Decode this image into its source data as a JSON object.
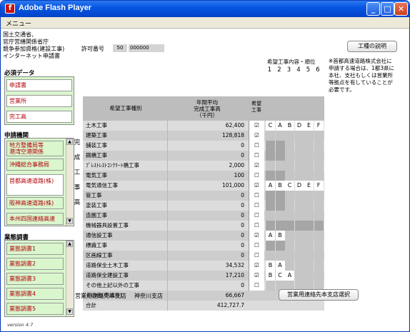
{
  "window": {
    "title": "Adobe Flash Player",
    "menu": "メニュー",
    "app_icon": "flash-icon",
    "minimize": "_",
    "maximize": "□",
    "close": "✕"
  },
  "ministry": [
    "国土交通省、",
    "官庁営繕関係省庁",
    "競争参加資格(建設工事)",
    "インターネット申請書"
  ],
  "permit": {
    "label": "許可番号",
    "code1": "50",
    "code2": "000000"
  },
  "explain_button": "工種の説明",
  "required": {
    "heading": "必須データ",
    "items": [
      "申請書",
      "営業所",
      "完工高"
    ]
  },
  "agency": {
    "heading": "申請機関",
    "items": [
      "地方整備局等\n港湾空港関係",
      "沖縄総合事務局",
      "首都高速道路(株)",
      "阪神高速道路(株)",
      "本州四国連絡高速"
    ]
  },
  "survey": {
    "heading": "業態調書",
    "items": [
      "業態調書1",
      "業態調書2",
      "業態調書3",
      "業態調書4",
      "業態調書5"
    ]
  },
  "version": "version 4.7",
  "table": {
    "col_type": "希望工事種別",
    "col_avg": "年間平均\n完成工事高\n（千円）",
    "col_hope": "希望\n工事",
    "col_order": "希望工事内容・順位",
    "order_nums": [
      "1",
      "2",
      "3",
      "4",
      "5",
      "6"
    ],
    "side_label": "完成工事高",
    "rows": [
      {
        "name": "土木工事",
        "amount": "62,400",
        "checked": true,
        "order": [
          "C",
          "A",
          "B",
          "D",
          "E",
          "F"
        ]
      },
      {
        "name": "建築工事",
        "amount": "128,818",
        "checked": true,
        "order": []
      },
      {
        "name": "舗装工事",
        "amount": "0",
        "checked": false,
        "order": []
      },
      {
        "name": "鋼橋工事",
        "amount": "0",
        "checked": false,
        "order": []
      },
      {
        "name": "ﾌﾟﾚｽﾄﾚｽﾄｺﾝｸﾘｰﾄ橋工事",
        "amount": "2,000",
        "checked": true,
        "order": []
      },
      {
        "name": "電気工事",
        "amount": "100",
        "checked": false,
        "order": []
      },
      {
        "name": "電気通信工事",
        "amount": "101,000",
        "checked": true,
        "order": [
          "A",
          "B",
          "C",
          "D",
          "E",
          "F"
        ]
      },
      {
        "name": "管工事",
        "amount": "0",
        "checked": false,
        "order": []
      },
      {
        "name": "塗装工事",
        "amount": "0",
        "checked": false,
        "order": []
      },
      {
        "name": "造園工事",
        "amount": "0",
        "checked": false,
        "order": []
      },
      {
        "name": "機械器具設置工事",
        "amount": "0",
        "checked": false,
        "order": []
      },
      {
        "name": "通信設工事",
        "amount": "0",
        "checked": true,
        "order": [
          "A",
          "B"
        ]
      },
      {
        "name": "標識工事",
        "amount": "0",
        "checked": false,
        "order": []
      },
      {
        "name": "区画線工事",
        "amount": "0",
        "checked": false,
        "order": []
      },
      {
        "name": "道路保全土木工事",
        "amount": "34,532",
        "checked": true,
        "order": [
          "B",
          "A"
        ]
      },
      {
        "name": "道路保全建設工事",
        "amount": "17,210",
        "checked": true,
        "order": [
          "B",
          "C",
          "A"
        ]
      },
      {
        "name": "その他上記以外の工事",
        "amount": "0",
        "checked": false,
        "order": []
      },
      {
        "name": "その他(申請外)",
        "amount": "66,667",
        "checked": false,
        "order": []
      },
      {
        "name": "合計",
        "amount": "412,727.7",
        "checked": false,
        "order": []
      }
    ]
  },
  "notice": "※首都高速道路株式会社に申請する場合は、1都3県に本社、支社もしくは営業所等拠点を有していることが必要です。",
  "branch": {
    "label": "営業用連絡先本支店",
    "value": "神奈川支店",
    "select_button": "営業用連絡先本支店選択"
  },
  "colors": {
    "title_blue": "#0656e3",
    "item_red": "#b4000a",
    "panel_green": "#d9f6cd"
  }
}
